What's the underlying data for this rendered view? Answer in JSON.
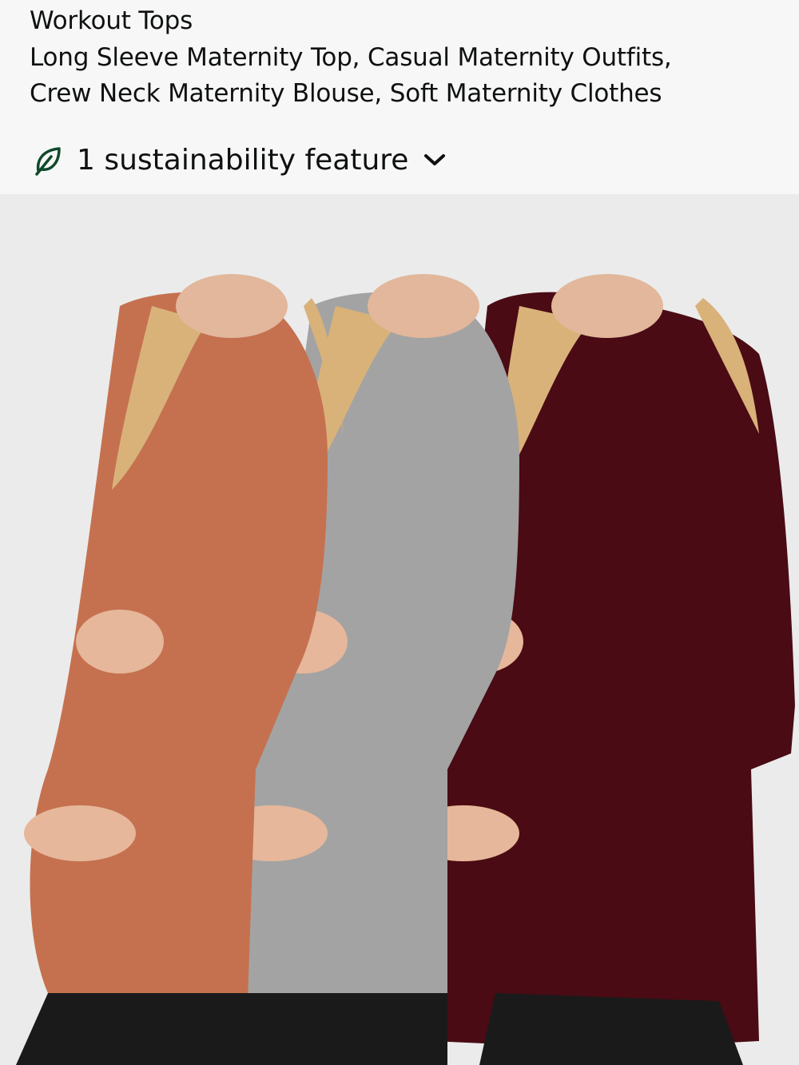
{
  "product": {
    "title_lines": [
      "Workout Tops",
      "Long Sleeve Maternity Top, Casual Maternity Outfits,",
      "Crew Neck Maternity Blouse, Soft Maternity Clothes"
    ]
  },
  "sustainability": {
    "label": "1 sustainability feature",
    "icon": "leaf-icon",
    "expand_icon": "chevron-down-icon",
    "leaf_color": "#0f4a2a"
  },
  "image": {
    "shirt_colors": [
      "#c5714f",
      "#a3a3a3",
      "#4a0b14"
    ],
    "background": "#ebebeb"
  }
}
